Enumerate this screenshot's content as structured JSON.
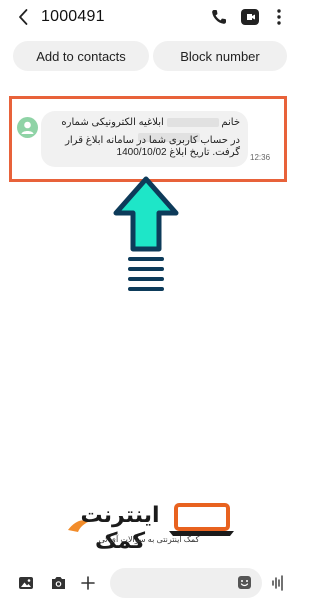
{
  "header": {
    "title": "1000491",
    "icons": [
      "back-arrow-icon",
      "phone-icon",
      "video-call-icon",
      "more-options-icon"
    ]
  },
  "actions": {
    "add_contacts": "Add to contacts",
    "block_number": "Block number"
  },
  "message": {
    "line1_prefix": "خانم",
    "line1_suffix": "ابلاغیه الکترونیکی شماره",
    "line2": "در حساب کاربری شما در سامانه ابلاغ قرار",
    "line3": "گرفت. تاریخ ابلاغ 1400/10/02",
    "time": "12:36"
  },
  "logo": {
    "name": "اینترنت کمک",
    "tagline": "کمک اینترنتی به سوالات آی تی"
  },
  "composer": {
    "icons": [
      "gallery-icon",
      "camera-icon",
      "add-icon",
      "sticker-icon",
      "voice-icon"
    ]
  },
  "colors": {
    "highlight": "#e8623a",
    "arrow_fill": "#1ee6c8",
    "arrow_stroke": "#0d3b5a",
    "avatar": "#8fd3a6"
  }
}
